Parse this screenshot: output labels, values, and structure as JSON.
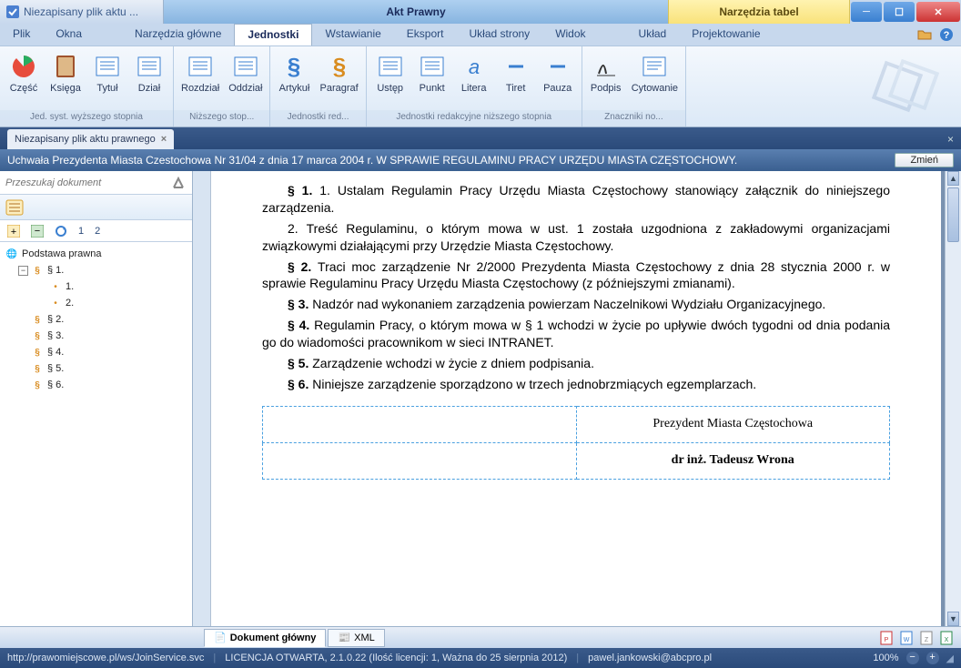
{
  "titlebar": {
    "left": "Niezapisany plik aktu ...",
    "center": "Akt Prawny",
    "tools": "Narzędzia tabel"
  },
  "menu": {
    "items": [
      "Plik",
      "Okna",
      "Narzędzia główne",
      "Jednostki",
      "Wstawianie",
      "Eksport",
      "Układ strony",
      "Widok",
      "Układ",
      "Projektowanie"
    ],
    "active_index": 3
  },
  "ribbon": {
    "groups": [
      {
        "label": "Jed. syst. wyższego stopnia",
        "buttons": [
          {
            "label": "Część",
            "icon": "pie"
          },
          {
            "label": "Księga",
            "icon": "book"
          },
          {
            "label": "Tytuł",
            "icon": "title"
          },
          {
            "label": "Dział",
            "icon": "dzial"
          }
        ]
      },
      {
        "label": "Niższego stop...",
        "buttons": [
          {
            "label": "Rozdział",
            "icon": "rozdzial"
          },
          {
            "label": "Oddział",
            "icon": "oddzial"
          }
        ]
      },
      {
        "label": "Jednostki red...",
        "buttons": [
          {
            "label": "Artykuł",
            "icon": "artykul"
          },
          {
            "label": "Paragraf",
            "icon": "paragraf"
          }
        ]
      },
      {
        "label": "Jednostki redakcyjne niższego stopnia",
        "buttons": [
          {
            "label": "Ustęp",
            "icon": "ustep"
          },
          {
            "label": "Punkt",
            "icon": "punkt"
          },
          {
            "label": "Litera",
            "icon": "litera"
          },
          {
            "label": "Tiret",
            "icon": "tiret"
          },
          {
            "label": "Pauza",
            "icon": "pauza"
          }
        ]
      },
      {
        "label": "Znaczniki no...",
        "buttons": [
          {
            "label": "Podpis",
            "icon": "podpis"
          },
          {
            "label": "Cytowanie",
            "icon": "cytowanie"
          }
        ]
      }
    ]
  },
  "doctab": {
    "label": "Niezapisany plik aktu prawnego"
  },
  "docheader": {
    "text": "Uchwała Prezydenta Miasta Czestochowa Nr 31/04 z dnia 17 marca 2004 r. W SPRAWIE REGULAMINU PRACY URZĘDU MIASTA CZĘSTOCHOWY.",
    "button": "Zmień"
  },
  "search": {
    "placeholder": "Przeszukaj dokument"
  },
  "treetoolbar": {
    "nums": [
      "1",
      "2"
    ]
  },
  "tree": {
    "root": "Podstawa prawna",
    "items": [
      {
        "label": "§ 1.",
        "children": [
          {
            "label": "1."
          },
          {
            "label": "2."
          }
        ]
      },
      {
        "label": "§ 2."
      },
      {
        "label": "§ 3."
      },
      {
        "label": "§ 4."
      },
      {
        "label": "§ 5."
      },
      {
        "label": "§ 6."
      }
    ]
  },
  "paragraphs": {
    "p1a": "§ 1. ",
    "p1b": "1. Ustalam Regulamin Pracy Urzędu Miasta Częstochowy stanowiący załącznik do niniejszego zarządzenia.",
    "p1c": "2. Treść Regulaminu, o którym mowa w ust. 1 została uzgodniona z zakładowymi organizacjami związkowymi działającymi przy Urzędzie Miasta Częstochowy.",
    "p2a": "§ 2. ",
    "p2b": "Traci moc zarządzenie Nr 2/2000 Prezydenta Miasta Częstochowy z dnia 28 stycznia 2000 r. w sprawie Regulaminu Pracy Urzędu Miasta Częstochowy (z późniejszymi zmianami).",
    "p3a": "§ 3. ",
    "p3b": "Nadzór nad wykonaniem zarządzenia powierzam Naczelnikowi Wydziału Organizacyjnego.",
    "p4a": "§ 4. ",
    "p4b": "Regulamin Pracy, o którym mowa w § 1 wchodzi w życie po upływie dwóch tygodni od dnia podania go do wiadomości pracownikom w sieci INTRANET.",
    "p5a": "§ 5. ",
    "p5b": "Zarządzenie wchodzi w życie z dniem podpisania.",
    "p6a": "§ 6. ",
    "p6b": "Niniejsze zarządzenie sporządzono w trzech jednobrzmiących egzemplarzach."
  },
  "signature": {
    "title": "Prezydent Miasta Częstochowa",
    "name": "dr inż. Tadeusz Wrona"
  },
  "bottom_tabs": {
    "main": "Dokument główny",
    "xml": "XML"
  },
  "status": {
    "url": "http://prawomiejscowe.pl/ws/JoinService.svc",
    "license": "LICENCJA OTWARTA, 2.1.0.22 (Ilość licencji: 1, Ważna do 25 sierpnia 2012)",
    "user": "pawel.jankowski@abcpro.pl",
    "zoom": "100%"
  }
}
